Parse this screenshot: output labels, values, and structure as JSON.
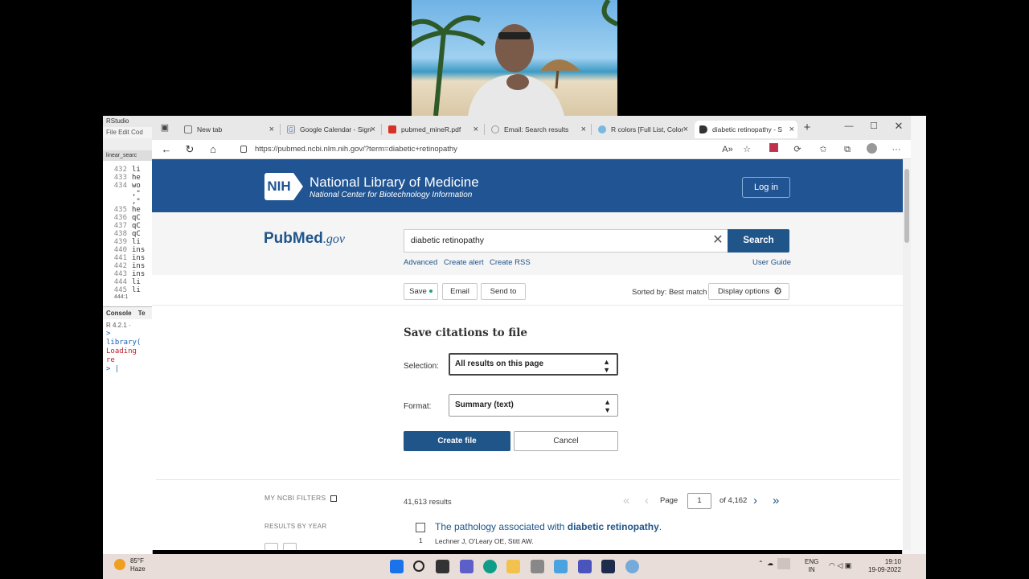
{
  "browser": {
    "tabs": [
      {
        "label": "New tab",
        "icon_color": "#ffffff",
        "active": false
      },
      {
        "label": "Google Calendar - Sign",
        "icon_color": "#4285f4",
        "active": false
      },
      {
        "label": "pubmed_mineR.pdf",
        "icon_color": "#d93025",
        "active": false
      },
      {
        "label": "Email: Search results",
        "icon_color": "#888888",
        "active": false
      },
      {
        "label": "R colors [Full List, Color",
        "icon_color": "#3c8dcd",
        "active": false
      },
      {
        "label": "diabetic retinopathy - S",
        "icon_color": "#333333",
        "active": true
      }
    ],
    "url": "https://pubmed.ncbi.nlm.nih.gov/?term=diabetic+retinopathy"
  },
  "nih": {
    "logo_text": "NIH",
    "title": "National Library of Medicine",
    "subtitle": "National Center for Biotechnology Information",
    "login_label": "Log in"
  },
  "pubmed": {
    "logo_main": "PubMed",
    "logo_suffix": ".gov",
    "search_value": "diabetic retinopathy",
    "search_button": "Search",
    "links": {
      "advanced": "Advanced",
      "create_alert": "Create alert",
      "create_rss": "Create RSS",
      "user_guide": "User Guide"
    }
  },
  "actions": {
    "save": "Save",
    "email": "Email",
    "send_to": "Send to",
    "sorted_by": "Sorted by: Best match",
    "display_options": "Display options"
  },
  "save_panel": {
    "title": "Save citations to file",
    "selection_label": "Selection:",
    "selection_value": "All results on this page",
    "format_label": "Format:",
    "format_value": "Summary (text)",
    "create_button": "Create file",
    "cancel_button": "Cancel"
  },
  "sidebar": {
    "my_ncbi_filters": "MY NCBI FILTERS",
    "results_by_year": "RESULTS BY YEAR"
  },
  "results": {
    "count": "41,613 results",
    "page_label": "Page",
    "page_value": "1",
    "page_total": "of 4,162",
    "items": [
      {
        "number": "1",
        "title_prefix": "The pathology associated with ",
        "title_bold": "diabetic retinopathy",
        "title_suffix": ".",
        "authors": "Lechner J, O'Leary OE, Stitt AW."
      }
    ]
  },
  "rstudio": {
    "title": "RStudio",
    "menu": "File  Edit  Cod",
    "file_tab": "linear_searc",
    "line_numbers": [
      "432",
      "433",
      "434",
      "",
      "",
      "435",
      "436",
      "437",
      "438",
      "439",
      "440",
      "441",
      "442",
      "443",
      "444",
      "445"
    ],
    "line_snippets": [
      "li",
      "he",
      "wo",
      ",\"",
      ",\"",
      "he",
      "qC",
      "qC",
      "qC",
      "li",
      "ins",
      "ins",
      "ins",
      "ins",
      "li",
      "li"
    ],
    "status": "444:1",
    "console_tab": "Console",
    "console_tab2": "Te",
    "r_version": "R 4.2.1 ·",
    "console_lines": [
      "> library(",
      "Loading re",
      "> |"
    ]
  },
  "taskbar": {
    "temperature": "85°F",
    "weather": "Haze",
    "lang_top": "ENG",
    "lang_bottom": "IN",
    "time": "19:10",
    "date": "19-09-2022"
  }
}
